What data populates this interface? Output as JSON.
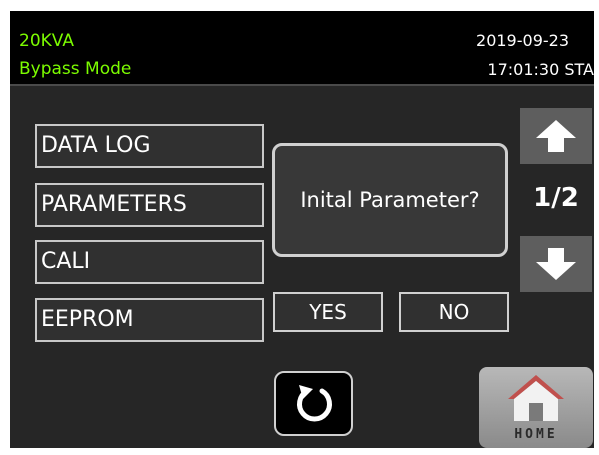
{
  "status": {
    "rating": "20KVA",
    "mode": "Bypass Mode",
    "date": "2019-09-23",
    "time": "17:01:30 STA"
  },
  "menu": {
    "items": [
      {
        "label": "DATA LOG"
      },
      {
        "label": "PARAMETERS"
      },
      {
        "label": "CALI"
      },
      {
        "label": "EEPROM"
      }
    ]
  },
  "dialog": {
    "message": "Inital Parameter?",
    "yes_label": "YES",
    "no_label": "NO"
  },
  "pager": {
    "indicator": "1/2",
    "up_icon": "arrow-up-icon",
    "down_icon": "arrow-down-icon"
  },
  "footer": {
    "back_icon": "refresh-back-icon",
    "home_label": "HOME",
    "home_icon": "house-icon"
  },
  "colors": {
    "status_green": "#7cfc00",
    "screen_bg": "#262626",
    "header_bg": "#000000",
    "roof_red": "#c0504d"
  }
}
